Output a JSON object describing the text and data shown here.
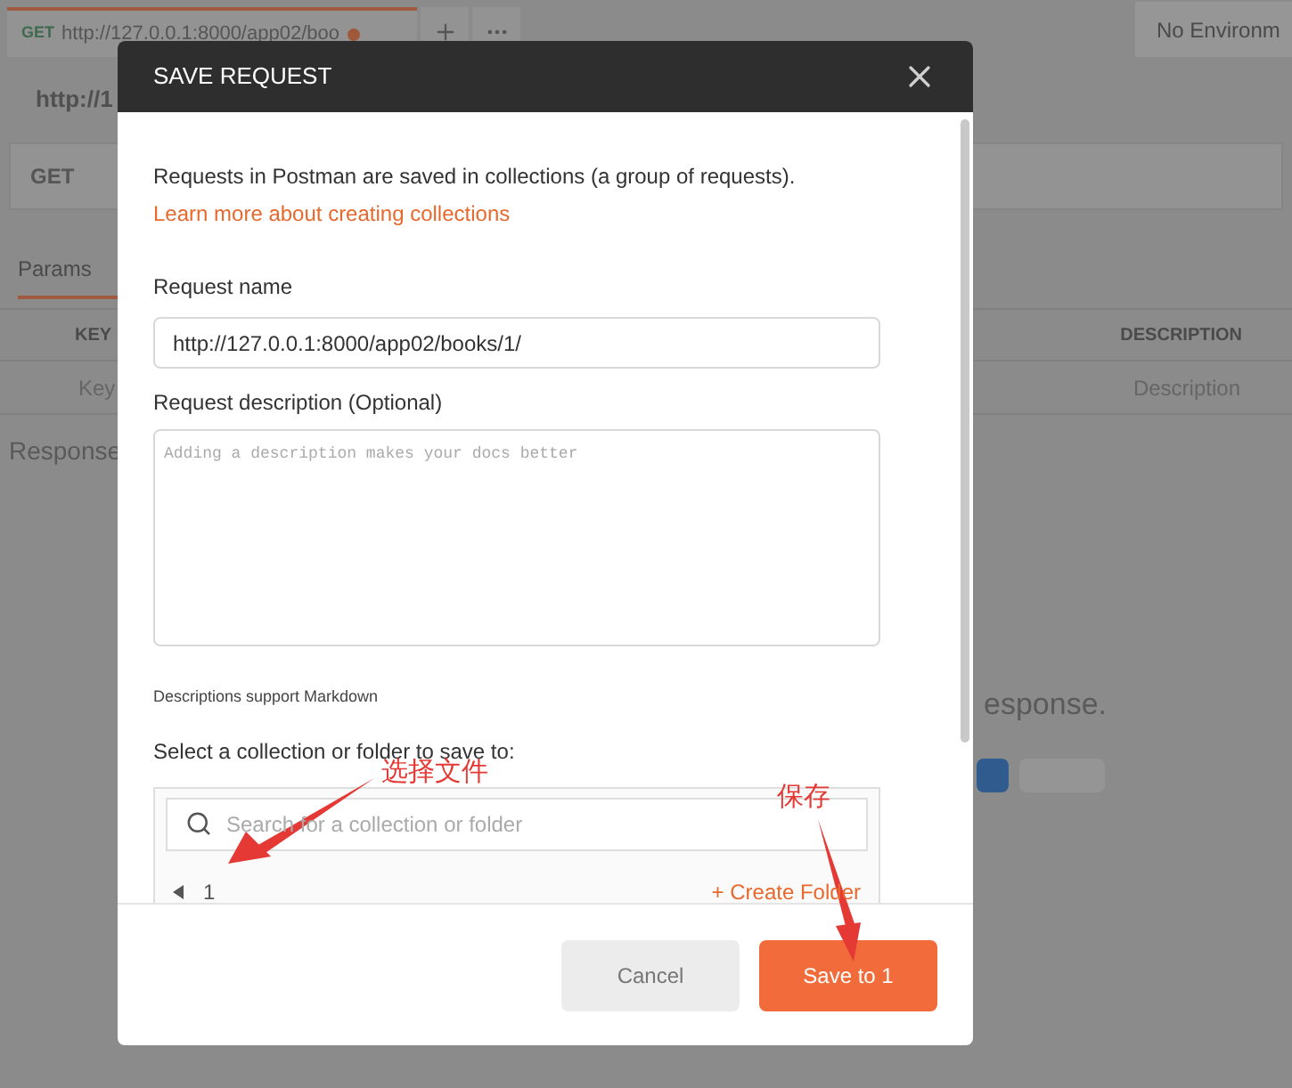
{
  "background": {
    "tab": {
      "method": "GET",
      "url": "http://127.0.0.1:8000/app02/boo",
      "unsaved": true
    },
    "environment": "No Environm",
    "url_title": "http://1",
    "method": "GET",
    "params_tab": "Params",
    "table": {
      "columns": [
        "KEY",
        "DESCRIPTION"
      ],
      "row": [
        "Key",
        "Description"
      ]
    },
    "response_label": "Response",
    "empty_message": "esponse."
  },
  "dialog": {
    "title": "SAVE REQUEST",
    "intro": "Requests in Postman are saved in collections (a group of requests).",
    "link": "Learn more about creating collections",
    "name_label": "Request name",
    "name_value": "http://127.0.0.1:8000/app02/books/1/",
    "description_label": "Request description (Optional)",
    "description_placeholder": "Adding a description makes your docs better",
    "markdown_note": "Descriptions support Markdown",
    "collection_label": "Select a collection or folder to save to:",
    "search_placeholder": "Search for a collection or folder",
    "collections": [
      {
        "name": "1",
        "expanded": false
      }
    ],
    "create_folder": "+ Create Folder",
    "cancel": "Cancel",
    "save": "Save to 1"
  },
  "annotations": [
    {
      "kind": "collection",
      "text": "选择文件"
    },
    {
      "kind": "save",
      "text": "保存"
    }
  ]
}
